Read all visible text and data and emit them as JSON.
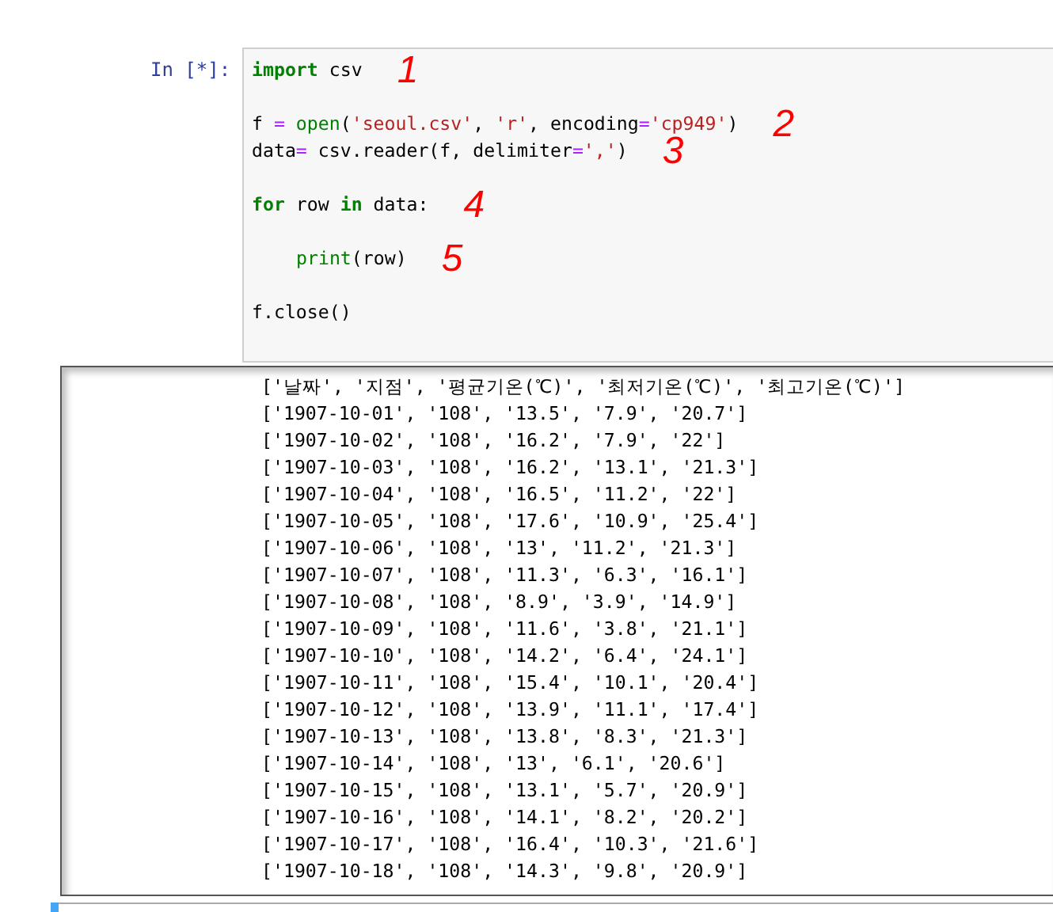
{
  "cell": {
    "prompt": "In [*]:",
    "code_lines": [
      {
        "gap_before": false,
        "tokens": [
          {
            "kind": "keyword",
            "text": "import"
          },
          {
            "kind": "plain",
            "text": " csv"
          }
        ],
        "annotation": "1"
      },
      {
        "gap_before": true,
        "tokens": [
          {
            "kind": "plain",
            "text": "f "
          },
          {
            "kind": "operator",
            "text": "="
          },
          {
            "kind": "builtin",
            "text": " open"
          },
          {
            "kind": "plain",
            "text": "("
          },
          {
            "kind": "string",
            "text": "'seoul.csv'"
          },
          {
            "kind": "plain",
            "text": ", "
          },
          {
            "kind": "string",
            "text": "'r'"
          },
          {
            "kind": "plain",
            "text": ", encoding"
          },
          {
            "kind": "operator",
            "text": "="
          },
          {
            "kind": "string",
            "text": "'cp949'"
          },
          {
            "kind": "plain",
            "text": ")"
          }
        ],
        "annotation": "2"
      },
      {
        "gap_before": false,
        "tokens": [
          {
            "kind": "plain",
            "text": "data"
          },
          {
            "kind": "operator",
            "text": "="
          },
          {
            "kind": "plain",
            "text": " csv.reader(f, delimiter"
          },
          {
            "kind": "operator",
            "text": "="
          },
          {
            "kind": "string",
            "text": "','"
          },
          {
            "kind": "plain",
            "text": ")"
          }
        ],
        "annotation": "3"
      },
      {
        "gap_before": true,
        "tokens": [
          {
            "kind": "keyword",
            "text": "for"
          },
          {
            "kind": "plain",
            "text": " row "
          },
          {
            "kind": "keyword",
            "text": "in"
          },
          {
            "kind": "plain",
            "text": " data:"
          }
        ],
        "annotation": "4"
      },
      {
        "gap_before": true,
        "indented": true,
        "tokens": [
          {
            "kind": "builtin",
            "text": "print"
          },
          {
            "kind": "plain",
            "text": "(row)"
          }
        ],
        "annotation": "5"
      },
      {
        "gap_before": true,
        "tokens": [
          {
            "kind": "plain",
            "text": "f.close()"
          }
        ]
      }
    ]
  },
  "output": {
    "lines": [
      "['날짜', '지점', '평균기온(℃)', '최저기온(℃)', '최고기온(℃)']",
      "['1907-10-01', '108', '13.5', '7.9', '20.7']",
      "['1907-10-02', '108', '16.2', '7.9', '22']",
      "['1907-10-03', '108', '16.2', '13.1', '21.3']",
      "['1907-10-04', '108', '16.5', '11.2', '22']",
      "['1907-10-05', '108', '17.6', '10.9', '25.4']",
      "['1907-10-06', '108', '13', '11.2', '21.3']",
      "['1907-10-07', '108', '11.3', '6.3', '16.1']",
      "['1907-10-08', '108', '8.9', '3.9', '14.9']",
      "['1907-10-09', '108', '11.6', '3.8', '21.1']",
      "['1907-10-10', '108', '14.2', '6.4', '24.1']",
      "['1907-10-11', '108', '15.4', '10.1', '20.4']",
      "['1907-10-12', '108', '13.9', '11.1', '17.4']",
      "['1907-10-13', '108', '13.8', '8.3', '21.3']",
      "['1907-10-14', '108', '13', '6.1', '20.6']",
      "['1907-10-15', '108', '13.1', '5.7', '20.9']",
      "['1907-10-16', '108', '14.1', '8.2', '20.2']",
      "['1907-10-17', '108', '16.4', '10.3', '21.6']",
      "['1907-10-18', '108', '14.3', '9.8', '20.9']"
    ]
  }
}
